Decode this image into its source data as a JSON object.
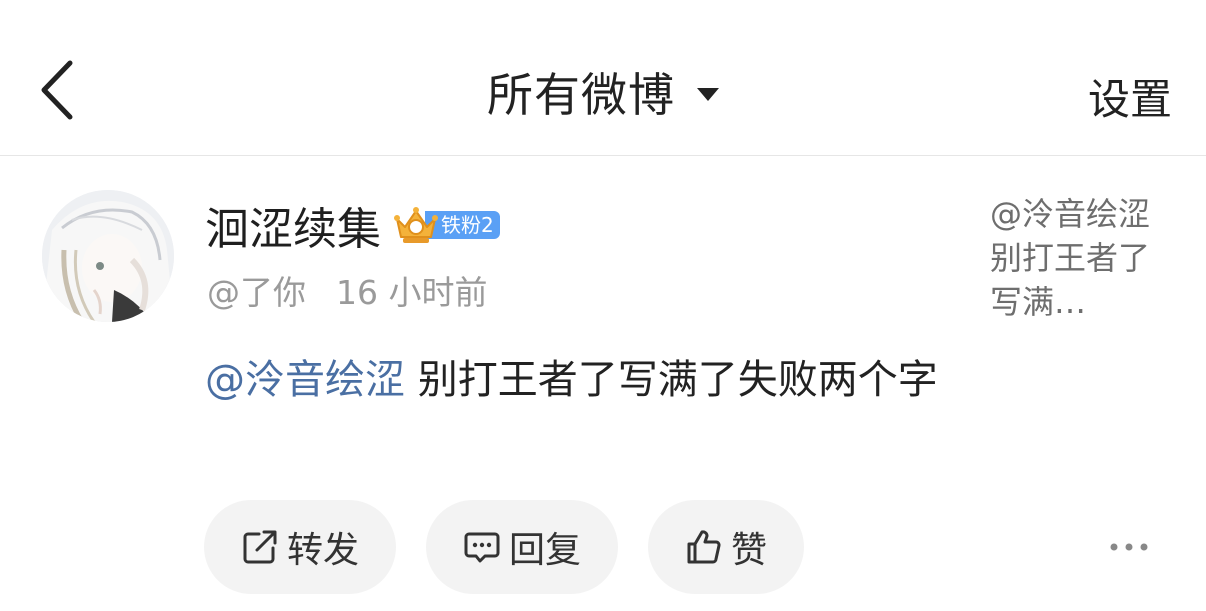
{
  "header": {
    "back_icon": "chevron-left-icon",
    "title": "所有微博",
    "title_dropdown_icon": "caret-down-icon",
    "settings_label": "设置"
  },
  "post": {
    "author": {
      "name": "洄涩续集",
      "badge_icon": "crown-icon",
      "badge_label": "铁粉2",
      "badge_color": "#5aa0f5"
    },
    "meta": {
      "reply_target": "@了你",
      "time": "16 小时前"
    },
    "content": {
      "mention": "@泠音绘涩",
      "text": " 别打王者了写满了失败两个字",
      "mention_color": "#4a6fa3"
    },
    "quote_preview": "@泠音绘涩 别打王者了写满…",
    "actions": {
      "forward_label": "转发",
      "forward_icon": "share-icon",
      "reply_label": "回复",
      "reply_icon": "comment-icon",
      "like_label": "赞",
      "like_icon": "thumbs-up-icon",
      "more_icon": "more-horizontal-icon"
    }
  }
}
